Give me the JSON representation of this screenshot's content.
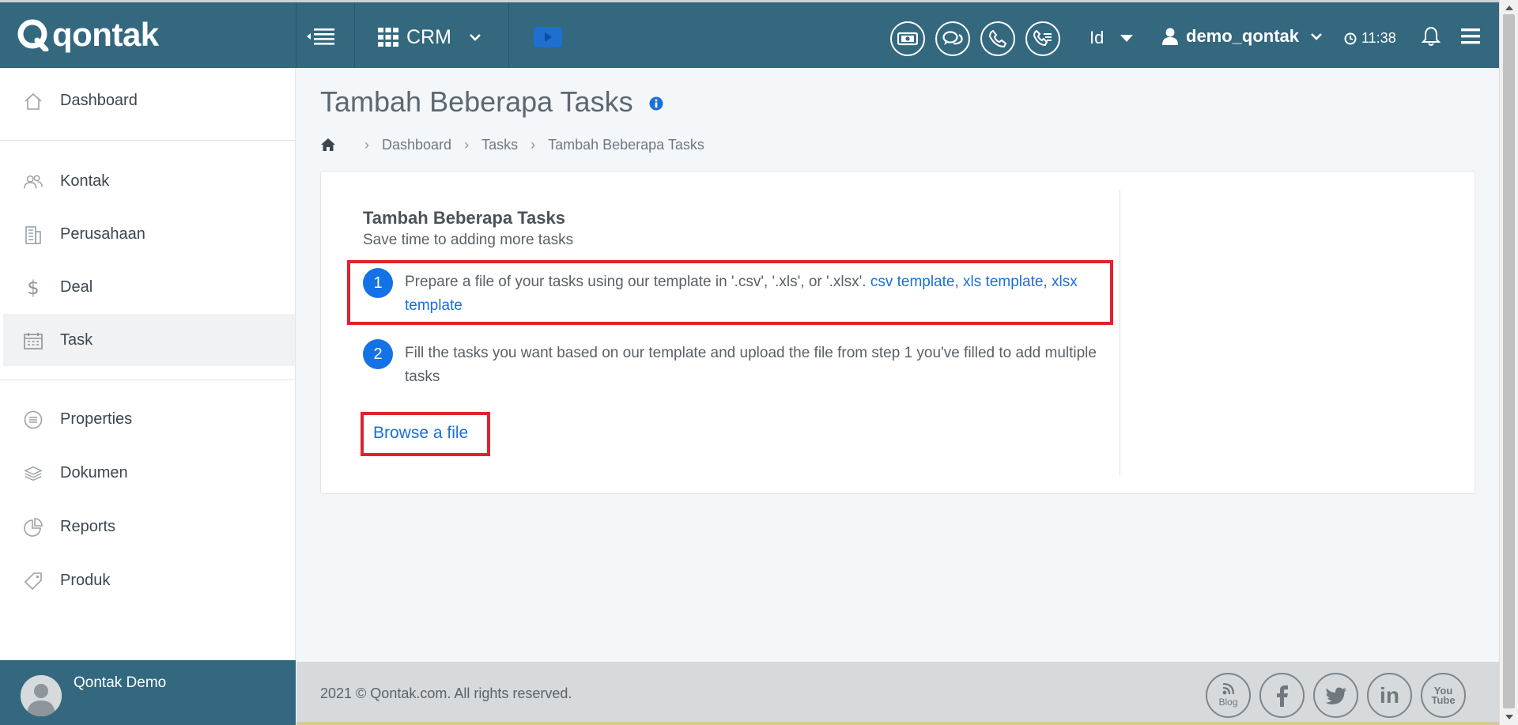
{
  "brand": {
    "name": "qontak"
  },
  "topbar": {
    "app_switch_label": "CRM",
    "lang": "Id",
    "username": "demo_qontak",
    "time": "11:38",
    "color": "#34687f"
  },
  "sidebar": {
    "items": [
      {
        "label": "Dashboard",
        "icon": "home-icon"
      },
      {
        "label": "Kontak",
        "icon": "contacts-icon"
      },
      {
        "label": "Perusahaan",
        "icon": "building-icon"
      },
      {
        "label": "Deal",
        "icon": "dollar-icon"
      },
      {
        "label": "Task",
        "icon": "calendar-icon"
      },
      {
        "label": "Properties",
        "icon": "list-circle-icon"
      },
      {
        "label": "Dokumen",
        "icon": "layers-icon"
      },
      {
        "label": "Reports",
        "icon": "pie-chart-icon"
      },
      {
        "label": "Produk",
        "icon": "tag-icon"
      }
    ],
    "active": "Task",
    "footer_user": "Qontak Demo"
  },
  "page": {
    "title": "Tambah Beberapa Tasks",
    "breadcrumb": [
      "Dashboard",
      "Tasks",
      "Tambah Beberapa Tasks"
    ]
  },
  "card": {
    "title": "Tambah Beberapa Tasks",
    "subtitle": "Save time to adding more tasks",
    "step1": {
      "num": "1",
      "text": "Prepare a file of your tasks using our template in '.csv', '.xls', or '.xlsx'. ",
      "link_csv": "csv template",
      "link_xls": "xls template",
      "link_xlsx": "xlsx template",
      "comma": ", "
    },
    "step2": {
      "num": "2",
      "text": "Fill the tasks you want based on our template and upload the file from step 1 you've filled to add multiple tasks"
    },
    "browse_label": "Browse a file",
    "link_color": "#1a6fd8",
    "highlight_color": "#e0222e"
  },
  "footer": {
    "copyright": "2021 © Qontak.com. All rights reserved.",
    "social": [
      {
        "name": "blog-icon",
        "label": "Blog"
      },
      {
        "name": "facebook-icon"
      },
      {
        "name": "twitter-icon"
      },
      {
        "name": "linkedin-icon",
        "label": "in"
      },
      {
        "name": "youtube-icon",
        "label": "You Tube"
      }
    ]
  }
}
